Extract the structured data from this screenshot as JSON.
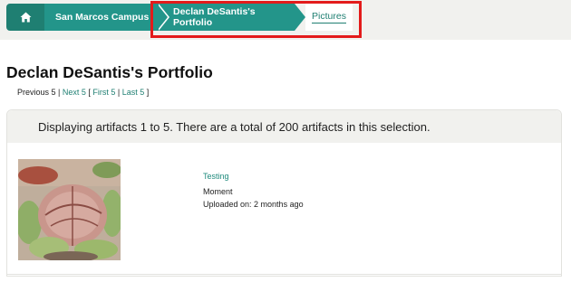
{
  "breadcrumb": {
    "campus": "San Marcos Campus",
    "portfolio": "Declan DeSantis's Portfolio",
    "current": "Pictures"
  },
  "page": {
    "title": "Declan DeSantis's Portfolio"
  },
  "pager": {
    "previous": "Previous 5",
    "sep1": " | ",
    "next": "Next 5",
    "open_bracket": " [ ",
    "first": "First 5",
    "sep2": " | ",
    "last": "Last 5",
    "close_bracket": " ]"
  },
  "results": {
    "summary": "Displaying artifacts 1 to 5. There are a total of 200 artifacts in this selection."
  },
  "artifacts": [
    {
      "title": "Testing",
      "type": "Moment",
      "uploaded": "Uploaded on: 2 months ago"
    }
  ],
  "colors": {
    "brand": "#1f7f72",
    "breadcrumb_green": "#23958a",
    "highlight_box": "#e31b1b"
  },
  "icons": {
    "home": "home-icon"
  }
}
